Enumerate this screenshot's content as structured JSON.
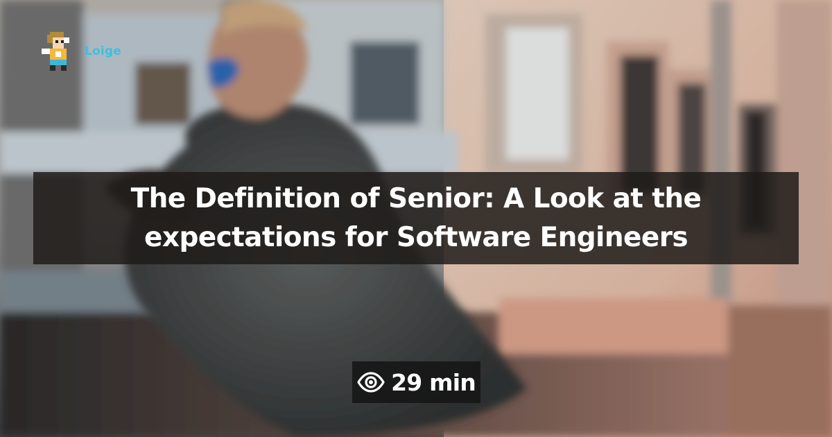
{
  "site": {
    "logo_icon": "pixel-avatar-icon",
    "name": "Loige"
  },
  "article": {
    "title": "The Definition of Senior: A Look at the expectations for Software Engineers"
  },
  "reading_time": {
    "icon": "eye-icon",
    "label": "29 min"
  },
  "colors": {
    "logo_text": "#39c2e0",
    "title_band": "#1e1a18",
    "title_text": "#ffffff",
    "badge_background": "#161616"
  }
}
